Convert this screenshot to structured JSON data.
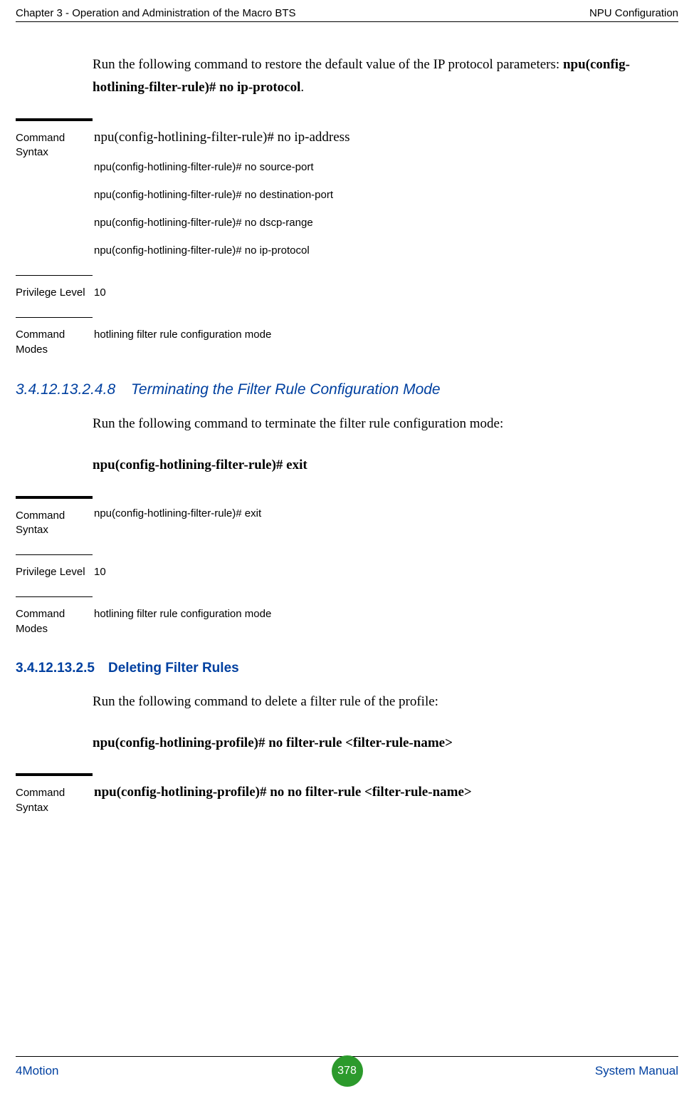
{
  "header": {
    "left": "Chapter 3 - Operation and Administration of the Macro BTS",
    "right": "NPU Configuration"
  },
  "intro": {
    "pre": "Run the following command to restore the default value of the IP protocol parameters: ",
    "bold": "npu(config-hotlining-filter-rule)# no ip-protocol",
    "post": "."
  },
  "table1": {
    "syntax_label": "Command Syntax",
    "syntax_lines_serif": "npu(config-hotlining-filter-rule)# no ip-address",
    "syntax_lines": [
      "npu(config-hotlining-filter-rule)# no source-port",
      "npu(config-hotlining-filter-rule)# no destination-port",
      "npu(config-hotlining-filter-rule)# no dscp-range",
      "npu(config-hotlining-filter-rule)# no ip-protocol"
    ],
    "priv_label": "Privilege Level",
    "priv_value": "10",
    "modes_label": "Command Modes",
    "modes_value": "hotlining filter rule configuration mode"
  },
  "section_4_8": {
    "num": "3.4.12.13.2.4.8",
    "title": "Terminating the Filter Rule Configuration Mode",
    "para": "Run the following command to terminate the filter rule configuration mode:",
    "cmd": "npu(config-hotlining-filter-rule)# exit"
  },
  "table2": {
    "syntax_label": "Command Syntax",
    "syntax_value": "npu(config-hotlining-filter-rule)# exit",
    "priv_label": "Privilege Level",
    "priv_value": "10",
    "modes_label": "Command Modes",
    "modes_value": "hotlining filter rule configuration mode"
  },
  "section_2_5": {
    "num": "3.4.12.13.2.5",
    "title": "Deleting Filter Rules",
    "para": "Run the following command to delete a filter rule of the profile:",
    "cmd": "npu(config-hotlining-profile)# no filter-rule <filter-rule-name>"
  },
  "table3": {
    "syntax_label": "Command Syntax",
    "syntax_value": "npu(config-hotlining-profile)# no no filter-rule <filter-rule-name>"
  },
  "footer": {
    "left": "4Motion",
    "page": "378",
    "right": "System Manual"
  }
}
